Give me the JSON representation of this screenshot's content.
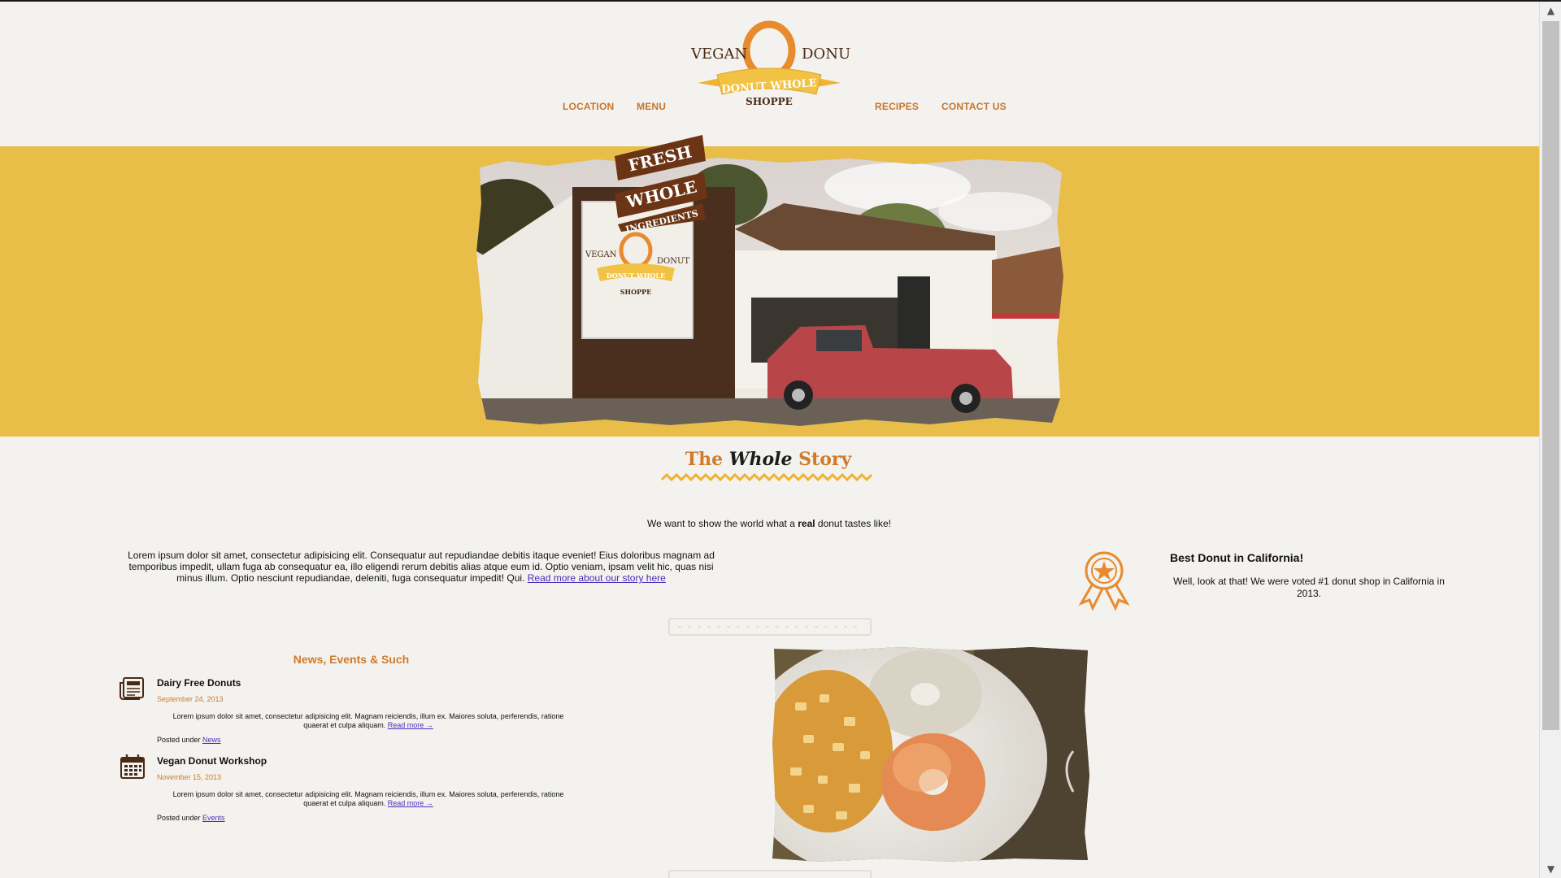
{
  "nav": {
    "location": "LOCATION",
    "menu": "MENU",
    "recipes": "RECIPES",
    "contact": "CONTACT US"
  },
  "logo": {
    "vegan": "VEGAN",
    "donut": "DONUT",
    "ribbon": "DONUT WHOLE",
    "shoppe": "SHOPPE"
  },
  "hero": {
    "ribbon_lines": [
      "FRESH",
      "WHOLE",
      "INGREDIENTS"
    ],
    "sign": {
      "vegan": "VEGAN",
      "donut": "DONUT",
      "ribbon": "DONUT WHOLE",
      "shoppe": "SHOPPE"
    }
  },
  "story": {
    "title_the": "The",
    "title_whole": "Whole",
    "title_story": "Story",
    "tagline_pre": "We want to show the world what a ",
    "tagline_bold": "real",
    "tagline_post": " donut tastes like!",
    "body": "Lorem ipsum dolor sit amet, consectetur adipisicing elit. Consequatur aut repudiandae debitis itaque eveniet! Eius doloribus magnam ad temporibus impedit, ullam fuga ab consequatur ea, illo eligendi rerum debitis alias atque eum id. Optio veniam, ipsam velit hic, quas nisi minus illum. Optio nesciunt repudiandae, deleniti, fuga consequatur impedit! Qui. ",
    "read_more": "Read more about our story here"
  },
  "award": {
    "title": "Best Donut in California!",
    "text": "Well, look at that! We were voted #1 donut shop in California in 2013."
  },
  "news": {
    "heading": "News, Events & Such",
    "items": [
      {
        "title": "Dairy Free Donuts",
        "date": "September 24, 2013",
        "body": "Lorem ipsum dolor sit amet, consectetur adipisicing elit. Magnam reiciendis, illum ex. Maiores soluta, perferendis, ratione quaerat et culpa aliquam. ",
        "read_more": "Read more →",
        "posted_label": "Posted under ",
        "category": "News",
        "icon": "newspaper-icon"
      },
      {
        "title": "Vegan Donut Workshop",
        "date": "November 15, 2013",
        "body": "Lorem ipsum dolor sit amet, consectetur adipisicing elit. Magnam reiciendis, illum ex. Maiores soluta, perferendis, ratione quaerat et culpa aliquam. ",
        "read_more": "Read more →",
        "posted_label": "Posted under ",
        "category": "Events",
        "icon": "calendar-icon"
      }
    ]
  },
  "colors": {
    "accent_orange": "#d07a2c",
    "hero_yellow": "#e8bd48",
    "ribbon_brown": "#6b3415",
    "link_purple": "#4b2dbd",
    "background": "#f3f2ee"
  }
}
